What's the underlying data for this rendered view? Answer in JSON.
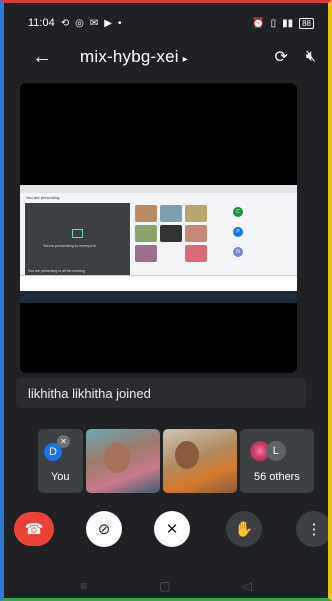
{
  "statusbar": {
    "time": "11:04",
    "left_icons": [
      "cast-icon",
      "whatsapp-icon",
      "sms-icon",
      "play-icon"
    ],
    "right_icons": [
      "alarm-icon",
      "vibrate-icon",
      "signal-icon",
      "battery-icon"
    ],
    "battery": "88"
  },
  "meeting": {
    "code": "mix-hybg-xei",
    "caret": "▸",
    "back_icon": "back-arrow-icon",
    "camera_switch_icon": "camera-switch-icon",
    "speaker_off_icon": "speaker-off-icon"
  },
  "shared_screen": {
    "presenting_text": "You are presenting",
    "pane_text": "You're presenting to everyone",
    "pane_bottom": "You are presenting to all the meeting",
    "side_letters": [
      "C",
      "P",
      "N"
    ]
  },
  "toast": {
    "text": "likhitha likhitha joined"
  },
  "participants": {
    "you_label": "You",
    "you_initial": "D",
    "others_label": "56 others",
    "others_initial": "L"
  },
  "controls": {
    "hangup": "end-call-icon",
    "camera": "camera-off-icon",
    "mic": "mic-off-icon",
    "raise_hand": "raise-hand-icon",
    "more": "more-vert-icon"
  },
  "navbar": [
    "recents-icon",
    "home-icon",
    "back-icon"
  ],
  "colors": {
    "hangup": "#ea4335",
    "avatar": "#1a73e8",
    "tile": "#3c4043"
  }
}
